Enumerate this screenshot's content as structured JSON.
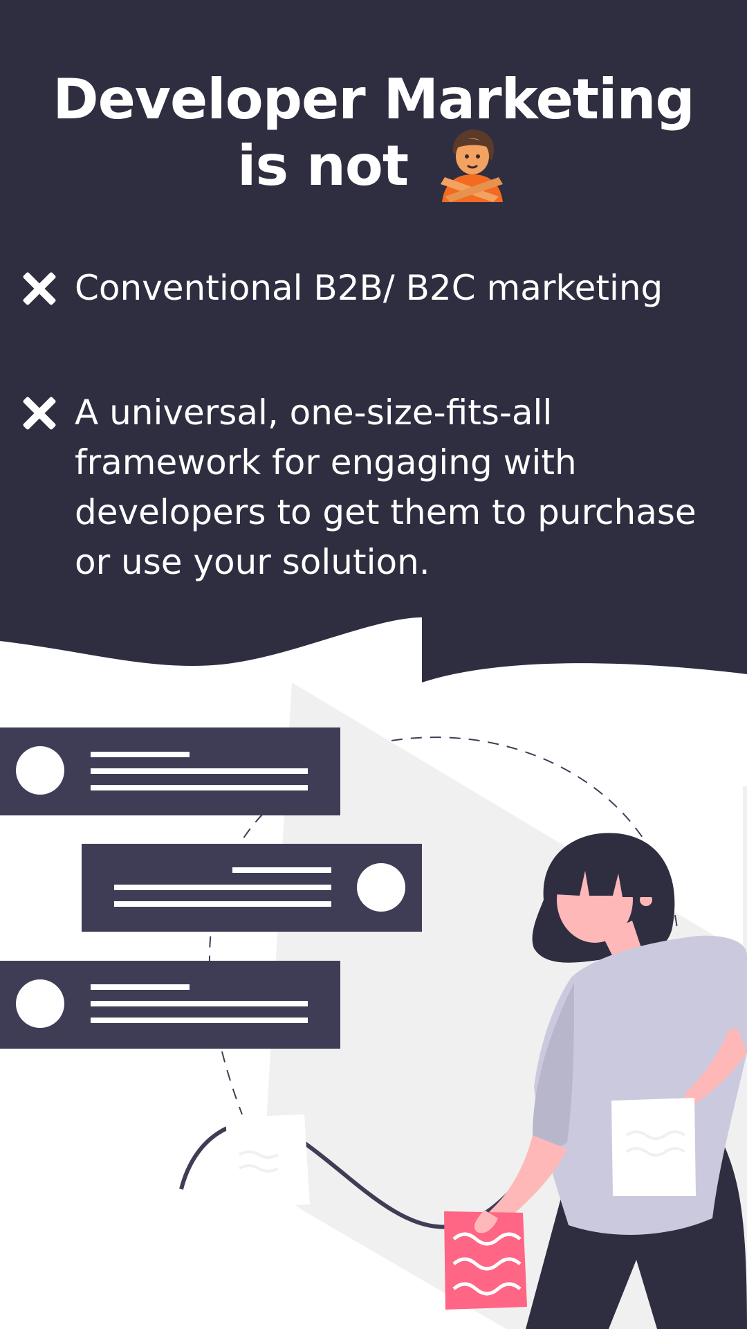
{
  "headline": {
    "title": "Developer Marketing is not",
    "emoji": "person-gesturing-no-emoji"
  },
  "items": [
    {
      "icon": "x-mark-icon",
      "text": "Conventional B2B/ B2C marketing"
    },
    {
      "icon": "x-mark-icon",
      "text": "A universal, one-size-fits-all framework for engaging with developers to get them to purchase or use your solution."
    }
  ],
  "colors": {
    "dark_background": "#2f2e41",
    "card": "#3f3d56",
    "text": "#ffffff",
    "accent_pink": "#ff6584",
    "shirt": "#cbc9de",
    "skin": "#ffb8b8",
    "backdrop_grey": "#f0f0f0"
  }
}
